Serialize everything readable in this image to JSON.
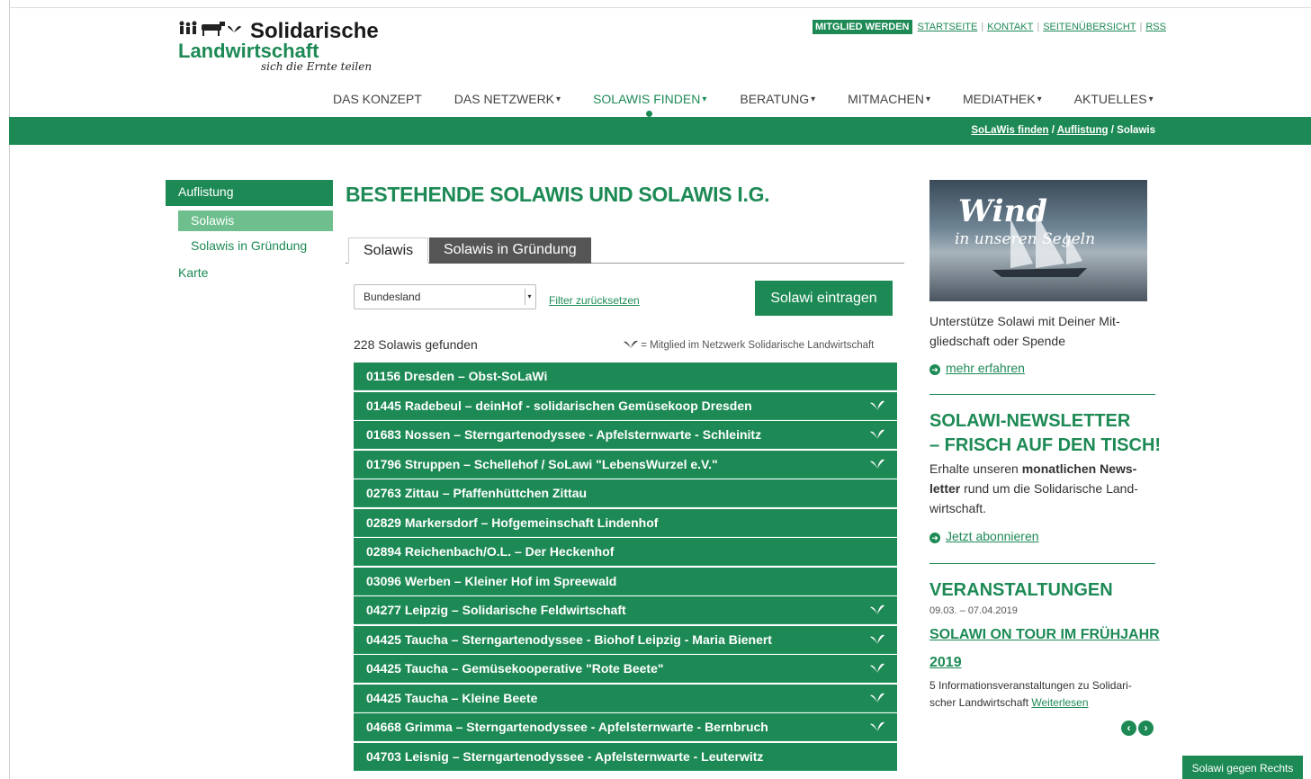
{
  "logo": {
    "line1": "Solidarische",
    "line2": "Landwirtschaft",
    "tagline": "sich die Ernte teilen",
    "icons": "👪🐄🌱"
  },
  "top_links": {
    "member": "MITGLIED WERDEN",
    "links": [
      "STARTSEITE",
      "KONTAKT",
      "SEITENÜBERSICHT",
      "RSS"
    ]
  },
  "nav": [
    {
      "label": "DAS KONZEPT",
      "caret": ""
    },
    {
      "label": "DAS NETZWERK",
      "caret": "▾"
    },
    {
      "label": "SOLAWIS FINDEN",
      "caret": "▾"
    },
    {
      "label": "BERATUNG",
      "caret": "▾"
    },
    {
      "label": "MITMACHEN",
      "caret": "▾"
    },
    {
      "label": "MEDIATHEK",
      "caret": "▾"
    },
    {
      "label": "AKTUELLES",
      "caret": "▾"
    }
  ],
  "breadcrumb": {
    "items": [
      "SoLaWis finden",
      "Auflistung"
    ],
    "current": "Solawis",
    "separator": " / "
  },
  "sidebar": {
    "heading": "Auflistung",
    "items": [
      "Solawis",
      "Solawis in Gründung"
    ],
    "karte": "Karte"
  },
  "main": {
    "title": "BESTEHENDE SOLAWIS UND SOLAWIS I.G.",
    "tabs": [
      "Solawis",
      "Solawis in Gründung"
    ],
    "select_value": "Bundesland",
    "filter_reset": "Filter zurücksetzen",
    "add_button": "Solawi eintragen",
    "count_number": "228",
    "count_text": " Solawis gefunden",
    "legend": "= Mitglied im Netzwerk Solidarische Landwirtschaft",
    "rows": [
      {
        "text": "01156 Dresden – Obst-SoLaWi",
        "member": false
      },
      {
        "text": "01445 Radebeul – deinHof - solidarischen Gemüsekoop Dresden",
        "member": true
      },
      {
        "text": "01683 Nossen – Sterngartenodyssee - Apfelsternwarte - Schleinitz",
        "member": true
      },
      {
        "text": "01796 Struppen – Schellehof / SoLawi \"LebensWurzel e.V.\"",
        "member": true
      },
      {
        "text": "02763 Zittau – Pfaffenhüttchen Zittau",
        "member": false
      },
      {
        "text": "02829 Markersdorf – Hofgemeinschaft Lindenhof",
        "member": false
      },
      {
        "text": "02894 Reichenbach/O.L. – Der Heckenhof",
        "member": false
      },
      {
        "text": "03096 Werben – Kleiner Hof im Spreewald",
        "member": false
      },
      {
        "text": "04277 Leipzig – Solidarische Feldwirtschaft",
        "member": true
      },
      {
        "text": "04425 Taucha – Sterngartenodyssee - Biohof Leipzig - Maria Bienert",
        "member": true
      },
      {
        "text": "04425 Taucha – Gemüsekooperative \"Rote Beete\"",
        "member": true
      },
      {
        "text": "04425 Taucha – Kleine Beete",
        "member": true
      },
      {
        "text": "04668 Grimma – Sterngartenodyssee - Apfelsternwarte - Bernbruch",
        "member": true
      },
      {
        "text": "04703 Leisnig – Sterngartenodyssee - Apfelsternwarte - Leuterwitz",
        "member": false
      }
    ]
  },
  "right": {
    "ad_title1": "Wind",
    "ad_title2": "in unseren Segeln",
    "support_text": "Unterstütze Solawi mit Deiner Mit-",
    "support_text2": "gliedschaft oder Spende",
    "more_link": "mehr erfahren",
    "newsletter_head1": "SOLAWI-NEWSLETTER",
    "newsletter_head2": "– FRISCH AUF DEN TISCH!",
    "newsletter_text_a": "Erhalte unseren ",
    "newsletter_text_b": "monatlichen News-",
    "newsletter_text_c": "letter",
    "newsletter_text_d": " rund um die Solidarische Land-",
    "newsletter_text_e": "wirtschaft.",
    "subscribe_link": "Jetzt abonnieren",
    "events_head": "VERANSTALTUNGEN",
    "event_date": "09.03. – 07.04.2019",
    "event_title": "SOLAWI ON TOUR IM FRÜHJAHR 2019",
    "event_desc": "5 Informationsveranstaltungen zu Solidari- scher Landwirtschaft ",
    "event_more": "Weiterlesen"
  },
  "footer_button": "Solawi gegen Rechts",
  "colors": {
    "brand_green": "#1d8a55",
    "light_green": "#6fbf8e",
    "tab_inactive": "#555555"
  },
  "icons": {
    "member_leaf": "seedling-icon",
    "arrow_circle": "arrow-right-circle-icon",
    "prev": "arrow-left-circle-icon",
    "next": "arrow-right-circle-icon"
  }
}
